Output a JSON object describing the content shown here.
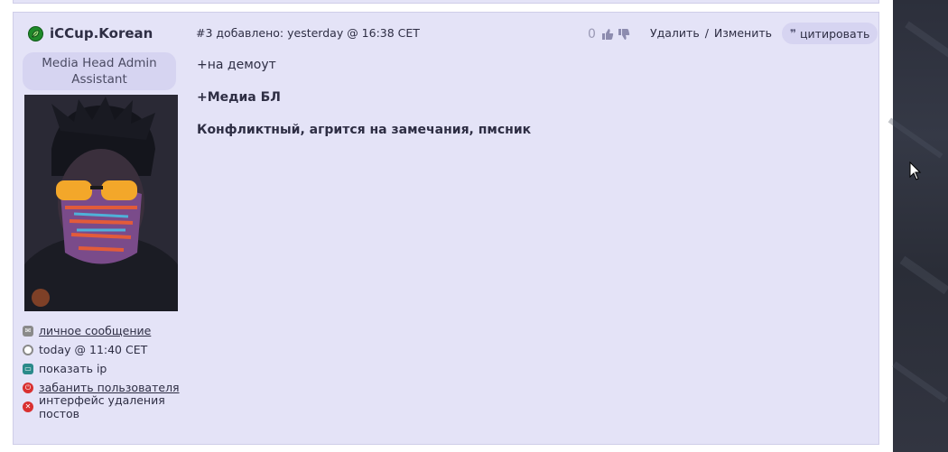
{
  "post": {
    "author": {
      "name": "iCCup.Korean",
      "role_line1": "Media Head Admin",
      "role_line2": "Assistant",
      "status_icon": "online-leaf-icon"
    },
    "user_actions": [
      {
        "label": "личное сообщение",
        "icon": "envelope-icon",
        "color": "#8a8a8a"
      },
      {
        "label": "today @ 11:40 CET",
        "icon": "clock-icon",
        "color": "#8a8a8a"
      },
      {
        "label": "показать ip",
        "icon": "monitor-icon",
        "color": "#2a8a8a"
      },
      {
        "label": "забанить пользователя",
        "icon": "power-icon",
        "color": "#d93030"
      },
      {
        "label": "интерфейс удаления постов",
        "icon": "delete-circle-icon",
        "color": "#d93030"
      }
    ],
    "meta": "#3 добавлено: yesterday @ 16:38 CET",
    "votes": {
      "count": "0"
    },
    "links": {
      "delete": "Удалить",
      "separator": "/",
      "edit": "Изменить"
    },
    "quote_label": "цитировать",
    "body": [
      {
        "text": "+на демоут",
        "bold": false
      },
      {
        "text": "+Медиа БЛ",
        "bold": true
      },
      {
        "text": "Конфликтный, агрится на замечания, пмсник",
        "bold": true
      }
    ]
  },
  "colors": {
    "post_bg": "#e4e3f7",
    "badge_bg": "#d6d4f1",
    "accent_green": "#1f8a2a",
    "danger_red": "#d93030"
  }
}
